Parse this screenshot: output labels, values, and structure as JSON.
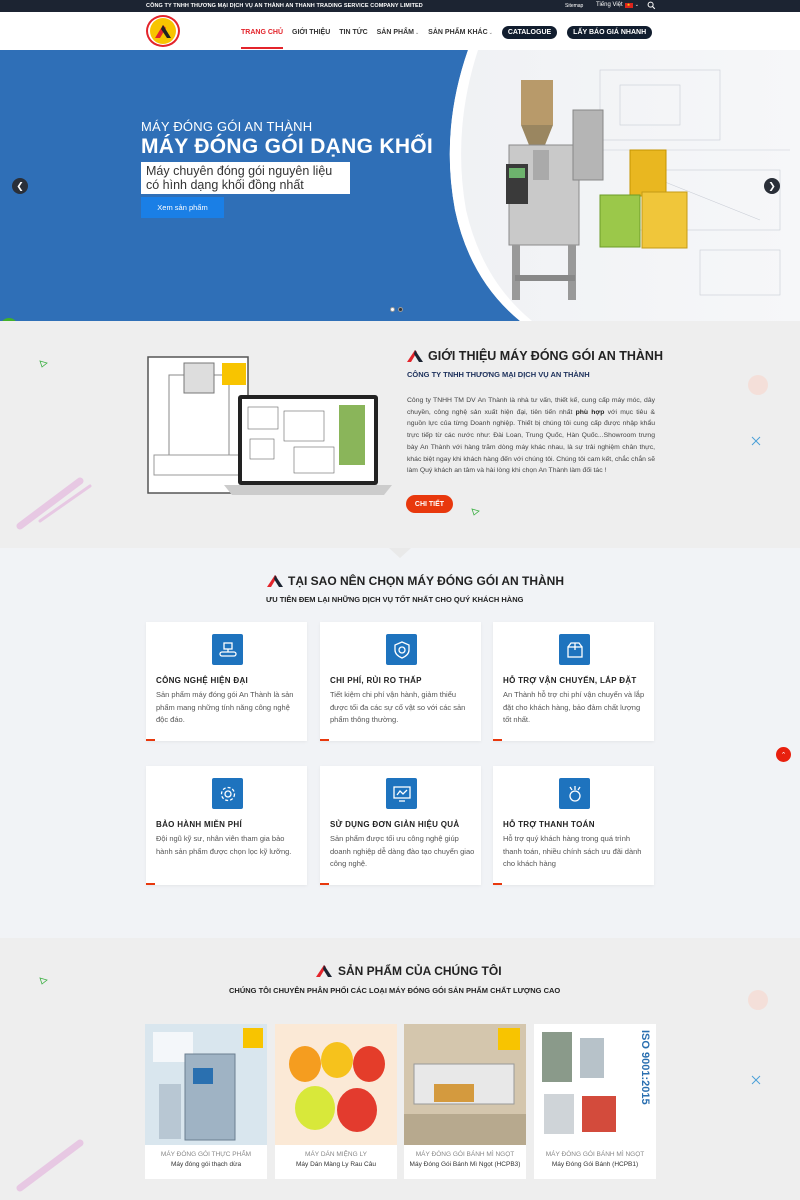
{
  "topbar": {
    "company": "CÔNG TY TNHH THƯƠNG MẠI DỊCH VỤ AN THÀNH AN THANH TRADING SERVICE COMPANY LIMITED",
    "sitemap": "Sitemap",
    "language": "Tiếng Việt"
  },
  "nav": {
    "items": [
      {
        "label": "TRANG CHỦ"
      },
      {
        "label": "GIỚI THIỆU"
      },
      {
        "label": "TIN TỨC"
      },
      {
        "label": "SẢN PHẨM"
      },
      {
        "label": "SẢN PHẨM KHÁC"
      }
    ],
    "catalogue": "CATALOGUE",
    "quote": "LẤY BÁO GIÁ NHANH"
  },
  "hero": {
    "kicker": "MÁY ĐÓNG GÓI AN THÀNH",
    "title": "MÁY ĐÓNG GÓI DẠNG KHỐI",
    "desc": "Máy chuyên đóng gói nguyên liệu có hình dạng khối đồng nhất",
    "button": "Xem sản phẩm",
    "slide_dots": 2,
    "active_slide": 2
  },
  "intro": {
    "title": "GIỚI THIỆU MÁY ĐÓNG GÓI AN THÀNH",
    "subtitle": "CÔNG TY TNHH THƯƠNG MẠI DỊCH VỤ AN THÀNH",
    "body_before": "Công ty TNHH TM DV An Thành là nhà tư vấn, thiết kế, cung cấp máy móc, dây chuyền, công nghệ sản xuất hiện đại, tiên tiến nhất ",
    "body_bold": "phù hợp",
    "body_after": " với mục tiêu & nguồn lực của từng Doanh nghiệp. Thiết bị chúng tôi cung cấp được nhập khẩu trực tiếp từ các nước như: Đài Loan, Trung Quốc, Hàn Quốc...Showroom trưng bày An Thành với hàng trăm dòng máy khác nhau, là sự trải nghiệm chân thực, khác biệt ngay khi khách hàng đến với chúng tôi. Chúng tôi cam kết, chắc chắn sẽ làm Quý khách an tâm và hài lòng khi chọn An Thành làm đối tác !",
    "button": "CHI TIẾT"
  },
  "why": {
    "title": "TẠI SAO NÊN CHỌN MÁY ĐÓNG GÓI AN THÀNH",
    "subtitle": "ƯU TIÊN ĐEM LẠI NHỮNG DỊCH VỤ TỐT NHẤT CHO QUÝ KHÁCH HÀNG",
    "cards": [
      {
        "icon": "conveyor-icon",
        "title": "CÔNG NGHỆ HIỆN ĐẠI",
        "desc": "Sản phẩm máy đóng gói An Thành là sản phẩm mang những tính năng công nghệ độc đáo."
      },
      {
        "icon": "shield-icon",
        "title": "CHI PHÍ, RỦI RO THẤP",
        "desc": "Tiết kiệm chi phí vận hành, giảm thiểu được tối đa các sự cố vật so với các sản phẩm thông thường."
      },
      {
        "icon": "box-icon",
        "title": "HỖ TRỢ VẬN CHUYỂN, LẮP ĐẶT",
        "desc": "An Thành hỗ trợ chi phí vận chuyển và lắp đặt cho khách hàng, bảo đảm chất lượng tốt nhất."
      },
      {
        "icon": "gear-icon",
        "title": "BẢO HÀNH MIỄN PHÍ",
        "desc": "Đội ngũ kỹ sư, nhân viên tham gia bảo hành sản phẩm được chọn lọc kỹ lưỡng."
      },
      {
        "icon": "monitor-icon",
        "title": "SỬ DỤNG ĐƠN GIẢN HIỆU QUẢ",
        "desc": "Sản phẩm được tối ưu công nghệ giúp doanh nghiệp dễ dàng đào tạo chuyển giao công nghệ."
      },
      {
        "icon": "payment-icon",
        "title": "HỖ TRỢ THANH TOÁN",
        "desc": "Hỗ trợ quý khách hàng trong quá trình thanh toán, nhiều chính sách ưu đãi dành cho khách hàng"
      }
    ]
  },
  "products": {
    "title": "SẢN PHẨM CỦA CHÚNG TÔI",
    "subtitle": "CHÚNG TÔI CHUYÊN PHÂN PHỐI CÁC LOẠI MÁY ĐÓNG GÓI SẢN PHẨM CHẤT LƯỢNG CAO",
    "items": [
      {
        "category": "MÁY ĐÓNG GÓI THỰC PHẨM",
        "name": "Máy đóng gói thạch dừa"
      },
      {
        "category": "MÁY DÁN MIỆNG LY",
        "name": "Máy Dán Màng Ly Rau Câu"
      },
      {
        "category": "MÁY ĐÓNG GÓI BÁNH MÌ NGỌT",
        "name": "Máy Đóng Gói Bánh Mì Ngọt (HCPB3)"
      },
      {
        "category": "MÁY ĐÓNG GÓI BÁNH MÌ NGỌT",
        "name": "Máy Đóng Gói Bánh (HCPB1)"
      }
    ],
    "iso_text": "ISO 9001:2015"
  },
  "colors": {
    "brand_red": "#e3242b",
    "hero_blue": "#2f6fb7",
    "icon_blue": "#1e73be",
    "cta_orange": "#e8380d",
    "dark": "#1c2432"
  }
}
